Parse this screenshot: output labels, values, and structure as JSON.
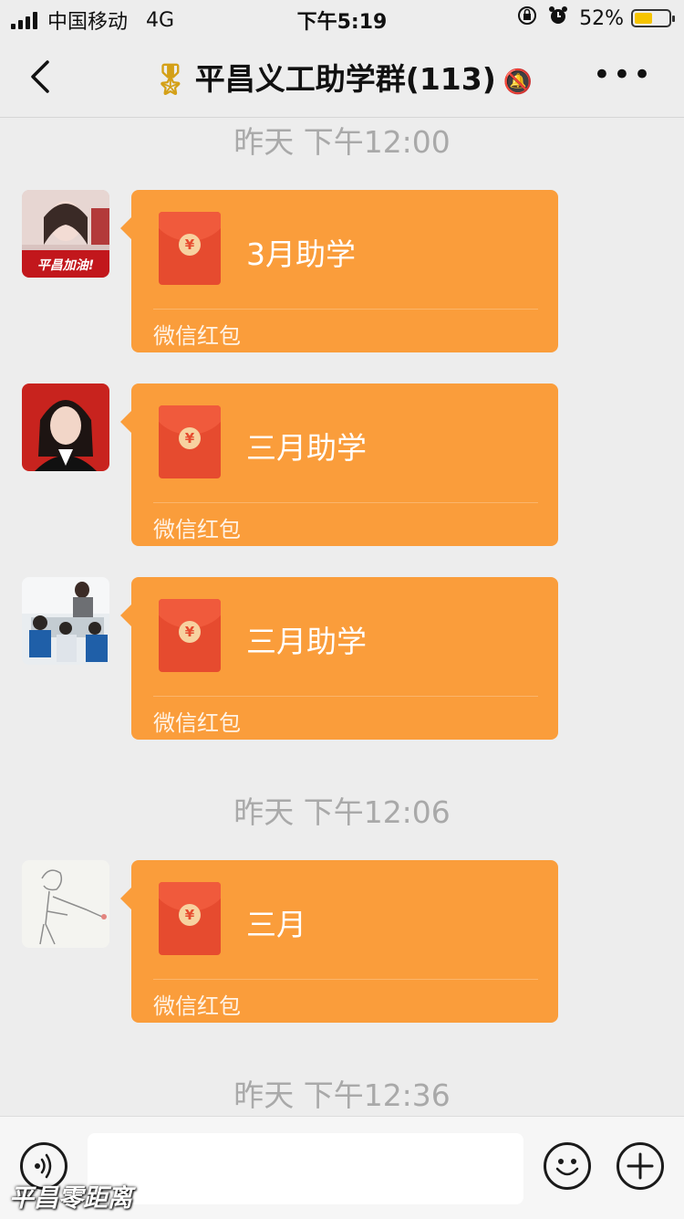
{
  "status_bar": {
    "carrier": "中国移动",
    "network": "4G",
    "time": "下午5:19",
    "battery": "52%",
    "battery_level": 0.52
  },
  "nav": {
    "title": "平昌义工助学群(113)",
    "icons": [
      "back-chevron-icon",
      "medal-icon",
      "mute-bell-icon",
      "more-icon"
    ]
  },
  "chat": {
    "timestamps": [
      "昨天 下午12:00",
      "昨天 下午12:06",
      "昨天 下午12:36"
    ],
    "messages": [
      {
        "text": "3月助学",
        "footer": "微信红包",
        "avatar_badge": "平昌加油!"
      },
      {
        "text": "三月助学",
        "footer": "微信红包"
      },
      {
        "text": "三月助学",
        "footer": "微信红包"
      },
      {
        "text": "三月",
        "footer": "微信红包"
      }
    ],
    "coin_symbol": "¥"
  },
  "input_bar": {
    "value": "",
    "placeholder": "",
    "icons": [
      "voice-icon",
      "emoji-icon",
      "plus-icon"
    ]
  },
  "watermark": "平昌零距离",
  "colors": {
    "background": "#ededed",
    "red_packet_bubble": "#fa9d3b",
    "envelope": "#e64b2f",
    "timestamp_text": "#a9a9a9"
  }
}
